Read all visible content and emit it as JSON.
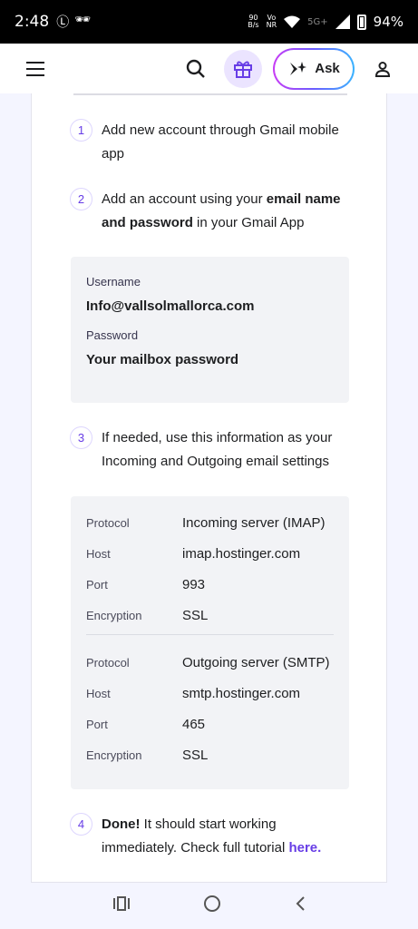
{
  "status_bar": {
    "time": "2:48",
    "data_rate_top": "90",
    "data_rate_bottom": "B/s",
    "volte_top": "Vo",
    "volte_bottom": "NR",
    "network": "5G+",
    "battery": "94%"
  },
  "header": {
    "ask_label": "Ask",
    "icons": [
      "hamburger-menu-icon",
      "search-icon",
      "gift-icon",
      "ai-sparkle-icon",
      "user-icon"
    ]
  },
  "steps": [
    {
      "num": "1",
      "text": "Add new account through Gmail mobile app"
    },
    {
      "num": "2",
      "pre": "Add an account using your ",
      "bold": "email name and password",
      "post": " in your Gmail App"
    },
    {
      "num": "3",
      "text": "If needed, use this information as your Incoming and Outgoing email settings"
    },
    {
      "num": "4",
      "bold": "Done!",
      "post": " It should start working immediately. Check full tutorial ",
      "link": "here."
    }
  ],
  "credentials": {
    "username_label": "Username",
    "username_value": "Info@vallsolmallorca.com",
    "password_label": "Password",
    "password_value": "Your mailbox password"
  },
  "incoming": [
    {
      "k": "Protocol",
      "v": "Incoming server (IMAP)"
    },
    {
      "k": "Host",
      "v": "imap.hostinger.com"
    },
    {
      "k": "Port",
      "v": "993"
    },
    {
      "k": "Encryption",
      "v": "SSL"
    }
  ],
  "outgoing": [
    {
      "k": "Protocol",
      "v": "Outgoing server (SMTP)"
    },
    {
      "k": "Host",
      "v": "smtp.hostinger.com"
    },
    {
      "k": "Port",
      "v": "465"
    },
    {
      "k": "Encryption",
      "v": "SSL"
    }
  ],
  "colors": {
    "accent": "#673de6",
    "background": "#f4f5ff"
  }
}
